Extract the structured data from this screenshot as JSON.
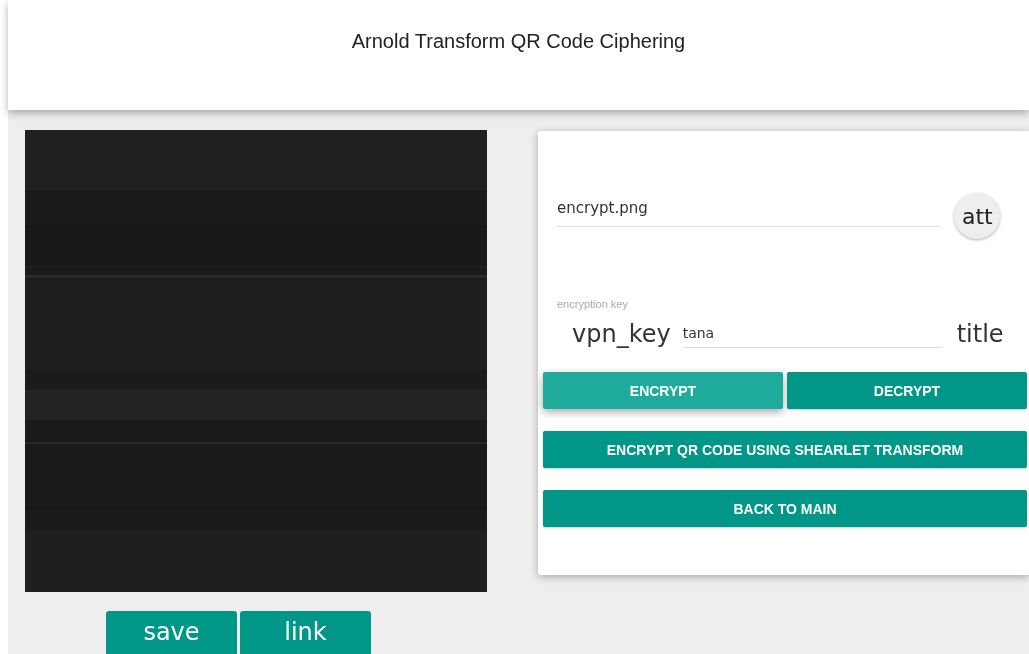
{
  "header": {
    "title": "Arnold Transform QR Code Ciphering"
  },
  "image_panel": {
    "buttons": [
      "save",
      "link"
    ]
  },
  "form": {
    "file_field": {
      "value": "encrypt.png"
    },
    "attach_button": {
      "label": "att"
    },
    "key_field": {
      "label": "encryption key",
      "prefix_icon_text": "vpn_key",
      "value": "tana",
      "suffix_icon_text": "title"
    },
    "action_row": [
      {
        "label": "ENCRYPT",
        "focused": true
      },
      {
        "label": "DECRYPT",
        "focused": false
      }
    ],
    "wide_buttons": [
      "ENCRYPT QR CODE USING SHEARLET TRANSFORM",
      "BACK TO MAIN"
    ]
  }
}
